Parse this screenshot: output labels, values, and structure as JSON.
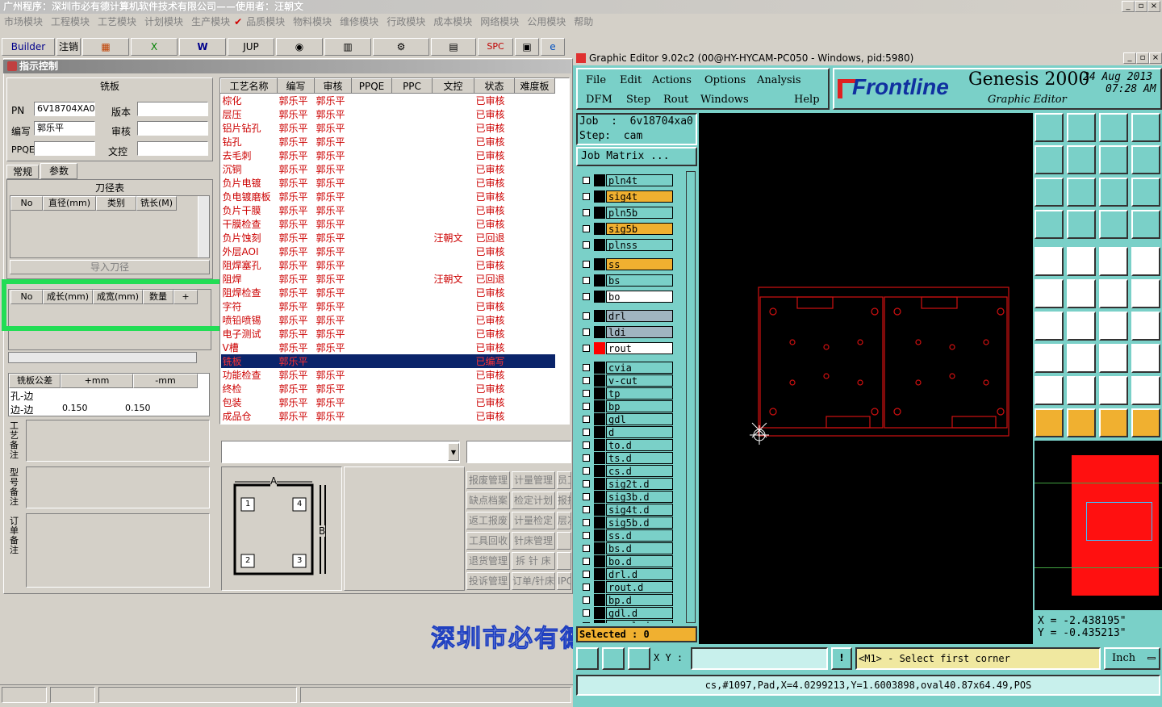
{
  "app": {
    "title": "广州程序：深圳市必有德计算机软件技术有限公司——使用者：汪朝文"
  },
  "menu": [
    "市场模块",
    "工程模块",
    "工艺模块",
    "计划模块",
    "生产模块",
    "✔",
    "品质模块",
    "物料模块",
    "维修模块",
    "行政模块",
    "成本模块",
    "网络模块",
    "公用模块",
    "帮助"
  ],
  "toolbar": {
    "builder": "Builder",
    "logout": "注销",
    "jup": "JUP",
    "spc": "SPC"
  },
  "left": {
    "title": "指示控制",
    "section": "铣板",
    "pn_label": "PN",
    "pn": "6V18704XA0",
    "ver_label": "版本",
    "author_label": "编写",
    "author": "郭乐平",
    "review_label": "审核",
    "ppqe_label": "PPQE",
    "copy_label": "文控",
    "tabs": [
      "常规",
      "参数"
    ],
    "tool_title": "刀径表",
    "tool_cols": [
      "No",
      "直径(mm)",
      "类别",
      "铣长(M)"
    ],
    "import_btn": "导入刀径",
    "size_cols": [
      "No",
      "成长(mm)",
      "成宽(mm)",
      "数量",
      "+"
    ],
    "tol_cols": [
      "铣板公差",
      "+mm",
      "-mm"
    ],
    "tol_rows": [
      {
        "name": "孔-边",
        "plus": "",
        "minus": ""
      },
      {
        "name": "边-边",
        "plus": "0.150",
        "minus": "0.150"
      }
    ],
    "note1": "工艺备注",
    "note2": "型号备注",
    "note3": "订单备注"
  },
  "proc": {
    "cols": [
      "工艺名称",
      "编写",
      "审核",
      "PPQE",
      "PPC",
      "文控",
      "状态",
      "难度板"
    ],
    "rows": [
      [
        "棕化",
        "郭乐平",
        "郭乐平",
        "",
        "",
        "",
        "已审核"
      ],
      [
        "层压",
        "郭乐平",
        "郭乐平",
        "",
        "",
        "",
        "已审核"
      ],
      [
        "铝片钻孔",
        "郭乐平",
        "郭乐平",
        "",
        "",
        "",
        "已审核"
      ],
      [
        "钻孔",
        "郭乐平",
        "郭乐平",
        "",
        "",
        "",
        "已审核"
      ],
      [
        "去毛刺",
        "郭乐平",
        "郭乐平",
        "",
        "",
        "",
        "已审核"
      ],
      [
        "沉铜",
        "郭乐平",
        "郭乐平",
        "",
        "",
        "",
        "已审核"
      ],
      [
        "负片电镀",
        "郭乐平",
        "郭乐平",
        "",
        "",
        "",
        "已审核"
      ],
      [
        "负电镀磨板",
        "郭乐平",
        "郭乐平",
        "",
        "",
        "",
        "已审核"
      ],
      [
        "负片干膜",
        "郭乐平",
        "郭乐平",
        "",
        "",
        "",
        "已审核"
      ],
      [
        "干膜检查",
        "郭乐平",
        "郭乐平",
        "",
        "",
        "",
        "已审核"
      ],
      [
        "负片蚀刻",
        "郭乐平",
        "郭乐平",
        "",
        "",
        "汪朝文",
        "已回退"
      ],
      [
        "外层AOI",
        "郭乐平",
        "郭乐平",
        "",
        "",
        "",
        "已审核"
      ],
      [
        "阻焊塞孔",
        "郭乐平",
        "郭乐平",
        "",
        "",
        "",
        "已审核"
      ],
      [
        "阻焊",
        "郭乐平",
        "郭乐平",
        "",
        "",
        "汪朝文",
        "已回退"
      ],
      [
        "阻焊检查",
        "郭乐平",
        "郭乐平",
        "",
        "",
        "",
        "已审核"
      ],
      [
        "字符",
        "郭乐平",
        "郭乐平",
        "",
        "",
        "",
        "已审核"
      ],
      [
        "喷铅喷锡",
        "郭乐平",
        "郭乐平",
        "",
        "",
        "",
        "已审核"
      ],
      [
        "电子测试",
        "郭乐平",
        "郭乐平",
        "",
        "",
        "",
        "已审核"
      ],
      [
        "V槽",
        "郭乐平",
        "郭乐平",
        "",
        "",
        "",
        "已审核"
      ],
      [
        "铣板",
        "郭乐平",
        "",
        "",
        "",
        "",
        "已编写"
      ],
      [
        "功能检查",
        "郭乐平",
        "郭乐平",
        "",
        "",
        "",
        "已审核"
      ],
      [
        "终检",
        "郭乐平",
        "郭乐平",
        "",
        "",
        "",
        "已审核"
      ],
      [
        "包装",
        "郭乐平",
        "郭乐平",
        "",
        "",
        "",
        "已审核"
      ],
      [
        "成品仓",
        "郭乐平",
        "郭乐平",
        "",
        "",
        "",
        "已审核"
      ]
    ],
    "selected": 19
  },
  "diagram": {
    "a": "A",
    "b": "B",
    "n1": "1",
    "n2": "2",
    "n3": "3",
    "n4": "4"
  },
  "sidebtns": [
    [
      "报废管理",
      "计量管理",
      "员工"
    ],
    [
      "缺点档案",
      "检定计划",
      "报损"
    ],
    [
      "返工报废",
      "计量检定",
      "层次"
    ],
    [
      "工具回收",
      "针床管理",
      ""
    ],
    [
      "退货管理",
      "拆 针 床",
      ""
    ],
    [
      "投诉管理",
      "订单/针床",
      "IPQ"
    ]
  ],
  "company": "深圳市必有德",
  "genesis": {
    "title": "Graphic Editor 9.02c2 (00@HY-HYCAM-PC050 - Windows, pid:5980)",
    "menu1": [
      "File",
      "Edit",
      "Actions",
      "Options",
      "Analysis"
    ],
    "menu2": [
      "DFM",
      "Step",
      "Rout",
      "Windows",
      "Help"
    ],
    "brand": "Frontline",
    "product": "Genesis 2000",
    "subtitle": "Graphic Editor",
    "date": "24 Aug 2013",
    "time": "07:28 AM",
    "job": "Job  :  6v18704xa0",
    "step": "Step:  cam",
    "jobmatrix": "Job Matrix ...",
    "layers": [
      {
        "n": "pln4t",
        "c": "#7ad0c8"
      },
      {
        "n": "sig4t",
        "c": "#f0b030"
      },
      {
        "n": "pln5b",
        "c": "#7ad0c8"
      },
      {
        "n": "sig5b",
        "c": "#f0b030"
      },
      {
        "n": "plnss",
        "c": "#7ad0c8"
      },
      {
        "n": "ss",
        "c": "#f0b030"
      },
      {
        "n": "bs",
        "c": "#7ad0c8"
      },
      {
        "n": "bo",
        "c": "#ffffff"
      },
      {
        "n": "drl",
        "c": "#a0b4c0"
      },
      {
        "n": "ldi",
        "c": "#a0b4c0"
      },
      {
        "n": "rout",
        "c": "#ffffff"
      },
      {
        "n": "cvia",
        "c": "#7ad0c8"
      },
      {
        "n": "v-cut",
        "c": "#7ad0c8"
      },
      {
        "n": "tp",
        "c": "#7ad0c8"
      },
      {
        "n": "bp",
        "c": "#7ad0c8"
      },
      {
        "n": "gdl",
        "c": "#7ad0c8"
      },
      {
        "n": "d",
        "c": "#7ad0c8"
      },
      {
        "n": "to.d",
        "c": "#7ad0c8"
      },
      {
        "n": "ts.d",
        "c": "#7ad0c8"
      },
      {
        "n": "cs.d",
        "c": "#7ad0c8"
      },
      {
        "n": "sig2t.d",
        "c": "#7ad0c8"
      },
      {
        "n": "sig3b.d",
        "c": "#7ad0c8"
      },
      {
        "n": "sig4t.d",
        "c": "#7ad0c8"
      },
      {
        "n": "sig5b.d",
        "c": "#7ad0c8"
      },
      {
        "n": "ss.d",
        "c": "#7ad0c8"
      },
      {
        "n": "bs.d",
        "c": "#7ad0c8"
      },
      {
        "n": "bo.d",
        "c": "#7ad0c8"
      },
      {
        "n": "drl.d",
        "c": "#7ad0c8"
      },
      {
        "n": "rout.d",
        "c": "#7ad0c8"
      },
      {
        "n": "bp.d",
        "c": "#7ad0c8"
      },
      {
        "n": "gdl.d",
        "c": "#7ad0c8"
      },
      {
        "n": "panel.d",
        "c": "#7ad0c8"
      }
    ],
    "selected": "Selected : 0",
    "xy_label": "X Y :",
    "prompt": "<M1> - Select first corner",
    "units": "Inch",
    "coord_x": "X = -2.438195\"",
    "coord_y": "Y = -0.435213\"",
    "status": "cs,#1097,Pad,X=4.0299213,Y=1.6003898,oval40.87x64.49,POS",
    "accent": "#7ad0c8"
  }
}
